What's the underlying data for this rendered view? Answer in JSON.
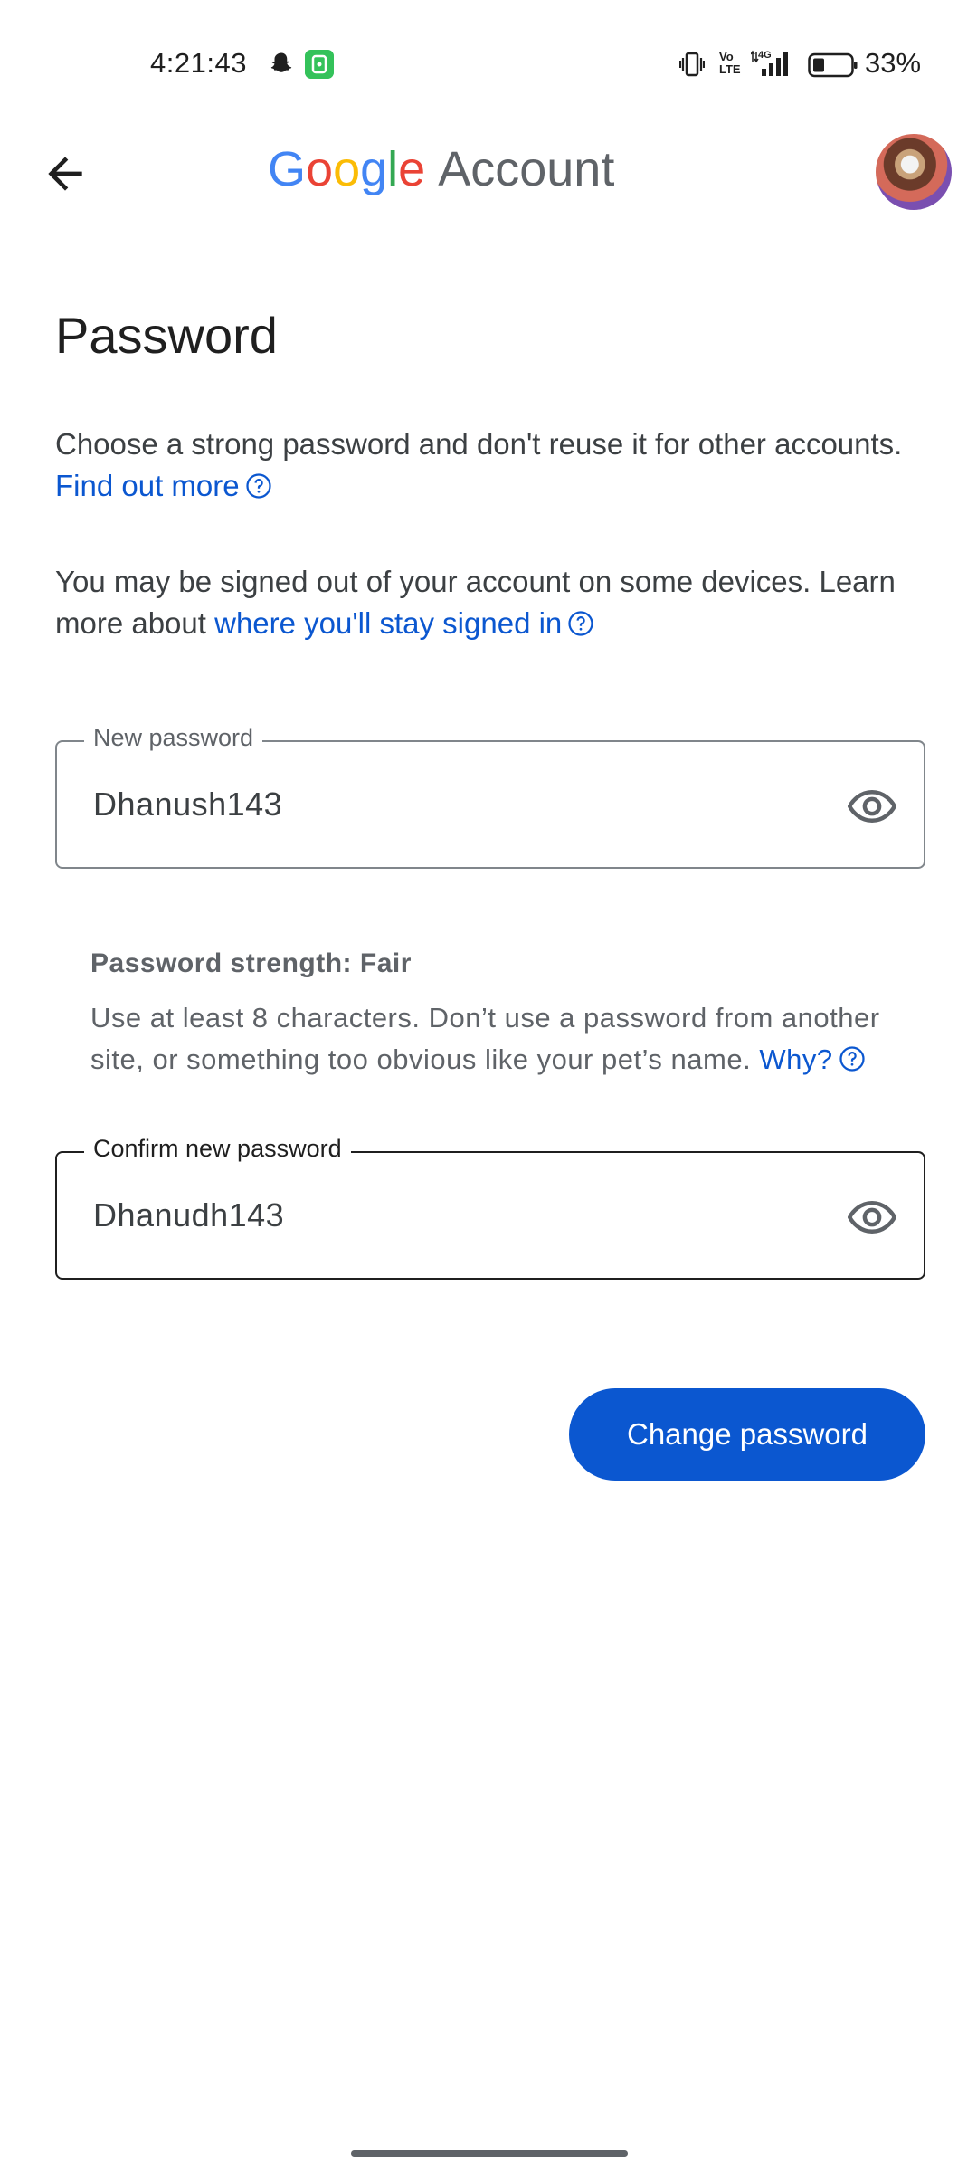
{
  "status_bar": {
    "time": "4:21:43",
    "network": "4G",
    "battery_percent": "33%",
    "icons": [
      "snapchat-icon",
      "app-notification-icon",
      "vibrate-icon",
      "volte-icon",
      "signal-icon",
      "battery-icon"
    ]
  },
  "app_bar": {
    "brand_letters": [
      "G",
      "o",
      "o",
      "g",
      "l",
      "e"
    ],
    "brand_suffix": "Account",
    "back_icon": "arrow-back-icon"
  },
  "page": {
    "title": "Password",
    "intro_text": "Choose a strong password and don't reuse it for other accounts.",
    "find_out_more_link": "Find out more",
    "signout_text_before": "You may be signed out of your account on some devices. Learn more about",
    "signout_link": "where you'll stay signed in"
  },
  "new_password": {
    "label": "New password",
    "value": "Dhanush143"
  },
  "strength": {
    "label": "Password strength: Fair",
    "hint": "Use at least 8 characters. Don’t use a password from another site, or something too obvious like your pet’s name.",
    "why_link": "Why?"
  },
  "confirm_password": {
    "label": "Confirm new password",
    "value": "Dhanudh143"
  },
  "actions": {
    "submit_label": "Change password"
  },
  "colors": {
    "link": "#0b57d0",
    "primary_button": "#0b57d0",
    "google_blue": "#4285f4",
    "google_red": "#ea4335",
    "google_yellow": "#fbbc05",
    "google_green": "#34a853"
  }
}
